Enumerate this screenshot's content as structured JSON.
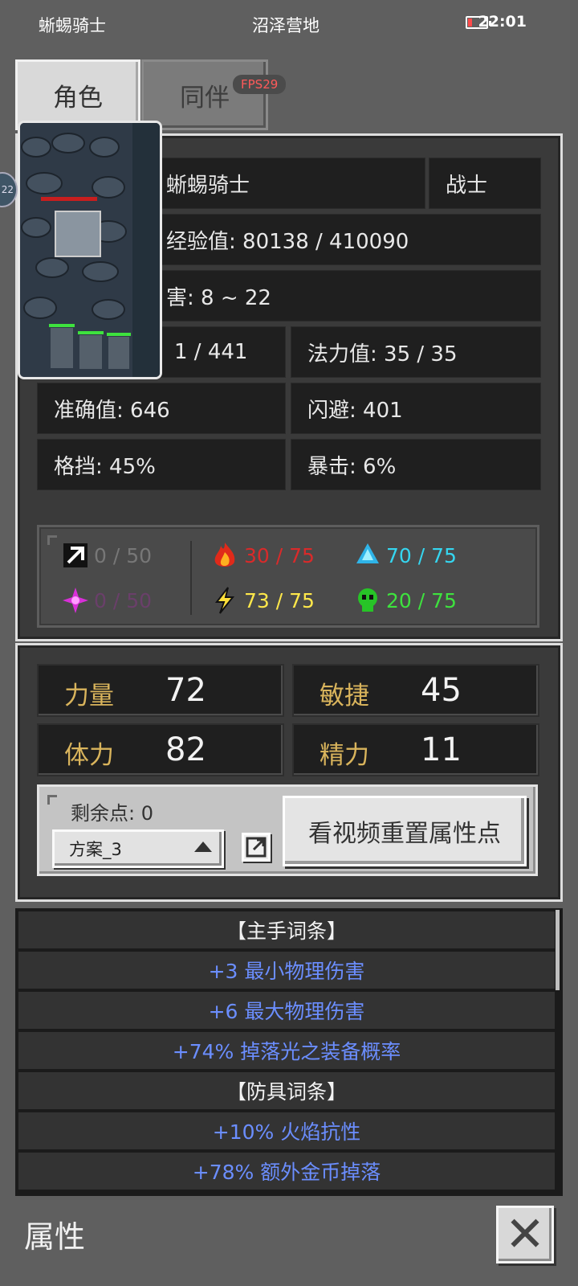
{
  "status_bar": {
    "left_text": "蜥蜴骑士",
    "center_text": "沼泽营地",
    "time": "22:01",
    "battery_color": "#ff4b4b"
  },
  "tabs": [
    {
      "label": "角色"
    },
    {
      "label": "同伴"
    }
  ],
  "fps": "FPS29",
  "side_bubble": "22",
  "character": {
    "name": "蜥蜴骑士",
    "class": "战士",
    "exp": "经验值: 80138 / 410090",
    "damage": "害: 8 ~ 22",
    "hp": "1 / 441",
    "mp": "法力值: 35 / 35",
    "accuracy": "准确值: 646",
    "dodge": "闪避: 401",
    "block": "格挡: 45%",
    "crit": "暴击: 6%"
  },
  "resistances": [
    {
      "icon": "physical-resist-icon",
      "value": "0 / 50",
      "color": "#777777"
    },
    {
      "icon": "fire-resist-icon",
      "value": "30 / 75",
      "color": "#d92a2a"
    },
    {
      "icon": "ice-resist-icon",
      "value": "70 / 75",
      "color": "#35d6f0"
    },
    {
      "icon": "arcane-resist-icon",
      "value": "0 / 50",
      "color": "#6a3f6a"
    },
    {
      "icon": "lightning-resist-icon",
      "value": "73 / 75",
      "color": "#ffe84a"
    },
    {
      "icon": "poison-resist-icon",
      "value": "20 / 75",
      "color": "#3ee23e"
    }
  ],
  "attributes": {
    "strength": {
      "label": "力量",
      "value": "72"
    },
    "agility": {
      "label": "敏捷",
      "value": "45"
    },
    "stamina": {
      "label": "体力",
      "value": "82"
    },
    "energy": {
      "label": "精力",
      "value": "11"
    }
  },
  "points": {
    "remaining": "剩余点: 0",
    "preset": "方案_3",
    "reset_button": "看视频重置属性点"
  },
  "affixes": [
    {
      "text": "【主手词条】",
      "type": "head"
    },
    {
      "text": "+3 最小物理伤害",
      "type": "item"
    },
    {
      "text": "+6 最大物理伤害",
      "type": "item"
    },
    {
      "text": "+74% 掉落光之装备概率",
      "type": "item"
    },
    {
      "text": "【防具词条】",
      "type": "head"
    },
    {
      "text": "+10% 火焰抗性",
      "type": "item"
    },
    {
      "text": "+78% 额外金币掉落",
      "type": "item"
    }
  ],
  "footer": {
    "title": "属性",
    "close_glyph": "✕"
  }
}
